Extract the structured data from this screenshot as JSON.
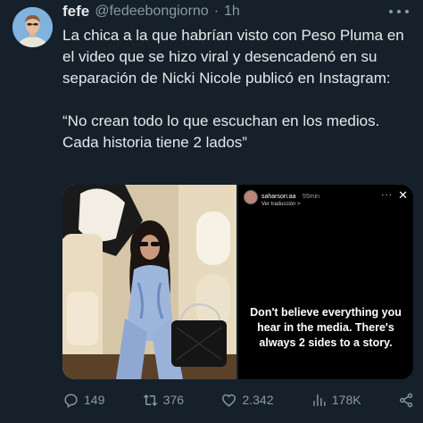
{
  "tweet": {
    "author": {
      "name": "fefe",
      "handle": "@fedeebongiorno",
      "separator": "·",
      "time": "1h"
    },
    "text_paragraph_1": "La chica a la que habrían visto con Peso Pluma en el video que se hizo viral y desencadenó en su separación de Nicki Nicole publicó en Instagram:",
    "text_paragraph_2": "“No crean todo lo que escuchan en los medios. Cada historia tiene 2 lados”",
    "story": {
      "username": "saharson:aa",
      "time": "55min",
      "translate": "Ver traducción >",
      "caption": "Don't believe everything you hear in the media. There's always 2 sides to a story."
    },
    "actions": {
      "replies": "149",
      "retweets": "376",
      "likes": "2.342",
      "views": "178K"
    }
  },
  "colors": {
    "background": "#15202b",
    "text_primary": "#e7e9ea",
    "text_secondary": "#8b98a5"
  },
  "icons": [
    "avatar",
    "more-icon",
    "reply-icon",
    "retweet-icon",
    "like-icon",
    "views-icon",
    "share-icon",
    "close-icon"
  ]
}
